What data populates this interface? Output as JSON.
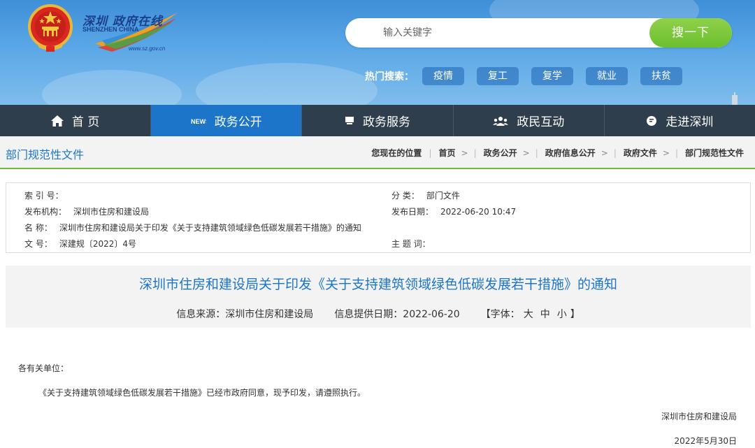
{
  "logo": {
    "cn": "深圳 政府在线",
    "en": "SHENZHEN CHINA",
    "url": "www.sz.gov.cn"
  },
  "search": {
    "placeholder": "输入关键字",
    "button_label": "搜一下"
  },
  "hot_search": {
    "label": "热门搜索：",
    "tags": [
      "疫情",
      "复工",
      "复学",
      "就业",
      "扶贫"
    ]
  },
  "nav": {
    "items": [
      {
        "label": "首 页",
        "icon": "home-icon"
      },
      {
        "label": "政务公开",
        "icon": "news-icon",
        "active": true
      },
      {
        "label": "政务服务",
        "icon": "monitor-icon"
      },
      {
        "label": "政民互动",
        "icon": "people-icon"
      },
      {
        "label": "走进深圳",
        "icon": "chat-icon"
      }
    ]
  },
  "breadcrumb": {
    "section_title": "部门规范性文件",
    "prefix": "您现在的位置",
    "items": [
      "首页",
      "政务公开",
      "政府信息公开",
      "政府文件",
      "部门规范性文件"
    ]
  },
  "meta": {
    "index_label": "索 引 号：",
    "index_value": "",
    "category_label": "分 类：",
    "category_value": "部门文件",
    "publisher_label": "发布机构：",
    "publisher_value": "深圳市住房和建设局",
    "date_label": "发布日期：",
    "date_value": "2022-06-20 10:47",
    "name_label": "名 称：",
    "name_value": "深圳市住房和建设局关于印发《关于支持建筑领域绿色低碳发展若干措施》的通知",
    "docno_label": "文 号：",
    "docno_value": "深建规〔2022〕4号",
    "keywords_label": "主 题 词：",
    "keywords_value": ""
  },
  "document": {
    "title": "深圳市住房和建设局关于印发《关于支持建筑领域绿色低碳发展若干措施》的通知",
    "source": "信息来源：深圳市住房和建设局",
    "provided_date": "信息提供日期：2022-06-20",
    "font_label_open": "【字体：",
    "font_large": "大",
    "font_medium": "中",
    "font_small": "小",
    "font_label_close": "】",
    "salutation": "各有关单位：",
    "paragraph": "《关于支持建筑领域绿色低碳发展若干措施》已经市政府同意，现予印发，请遵照执行。",
    "signature": "深圳市住房和建设局",
    "sign_date": "2022年5月30日"
  },
  "colors": {
    "nav_bg": "#2f3e4c",
    "nav_active": "#1c75c8",
    "accent_green": "#6cbf2f",
    "title_blue": "#1c75c8"
  }
}
